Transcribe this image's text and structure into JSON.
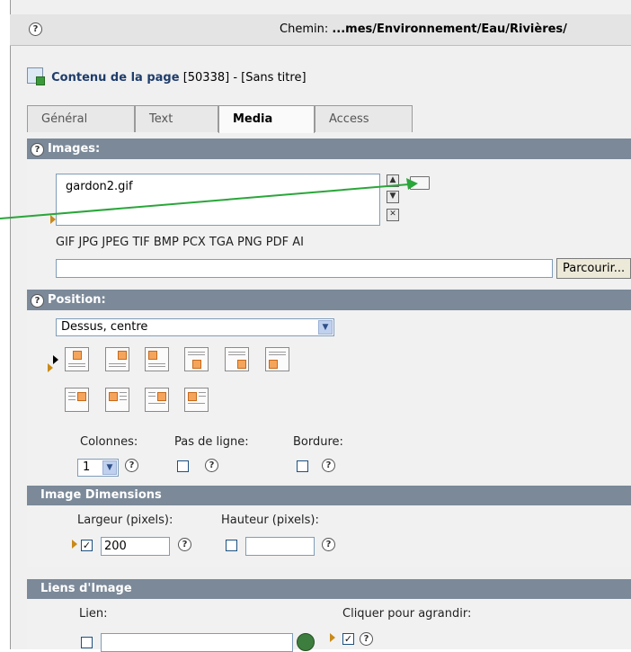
{
  "topbar": {
    "path_label": "Chemin:",
    "path_value": "...mes/Environnement/Eau/Rivières/"
  },
  "page": {
    "title_name": "Contenu de la page",
    "title_rest": "[50338] - [Sans titre]"
  },
  "tabs": [
    {
      "label": "Général"
    },
    {
      "label": "Text"
    },
    {
      "label": "Media"
    },
    {
      "label": "Access"
    }
  ],
  "images": {
    "section_title": "Images:",
    "file": "gardon2.gif",
    "extensions": "GIF JPG JPEG TIF BMP PCX TGA PNG PDF AI",
    "browse_label": "Parcourir..."
  },
  "position": {
    "section_title": "Position:",
    "selected": "Dessus, centre",
    "columns_label": "Colonnes:",
    "columns_value": "1",
    "noline_label": "Pas de ligne:",
    "border_label": "Bordure:"
  },
  "dimensions": {
    "section_title": "Image Dimensions",
    "width_label": "Largeur (pixels):",
    "height_label": "Hauteur (pixels):",
    "width_value": "200",
    "width_checked": "✓"
  },
  "links": {
    "section_title": "Liens d'Image",
    "link_label": "Lien:",
    "enlarge_label": "Cliquer pour agrandir:",
    "enlarge_checked": "✓"
  },
  "icons": [
    "help-icon",
    "page-content-icon",
    "folder-icon",
    "move-up-icon",
    "move-down-icon",
    "delete-icon",
    "dropdown-arrow-icon",
    "globe-link-icon"
  ],
  "colors": {
    "section_header": "#7b8999",
    "annotation_arrow": "#2aa63a",
    "image_thumb": "#f5a45b"
  }
}
